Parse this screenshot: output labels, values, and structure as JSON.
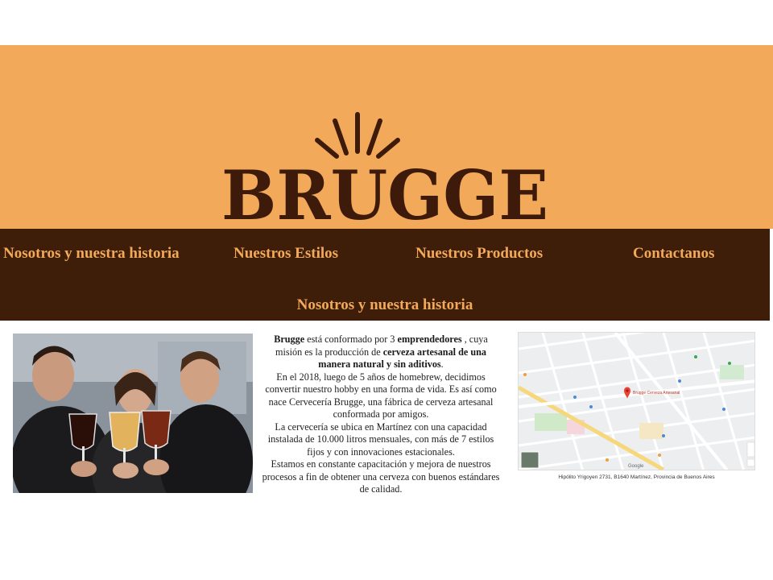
{
  "header": {
    "logo_text": "BRUGGE"
  },
  "nav": {
    "items": [
      {
        "label": "Nosotros y nuestra historia"
      },
      {
        "label": "Nuestros Estilos"
      },
      {
        "label": "Nuestros Productos"
      },
      {
        "label": "Contactanos"
      }
    ]
  },
  "section": {
    "title": "Nosotros y nuestra historia"
  },
  "about": {
    "brand": "Brugge",
    "p1_a": " está conformado por 3 ",
    "p1_b": "emprendedores",
    "p1_c": " , cuya misión es la producción de ",
    "p1_d": "cerveza artesanal de una manera natural y sin aditivos",
    "p1_e": ".",
    "p2": "En el 2018, luego de 5 años de homebrew, decidimos convertir nuestro hobby en una forma de vida. Es así como nace Cervecería Brugge, una fábrica de cerveza artesanal conformada por amigos.",
    "p3": "La cervecería se ubica en Martínez con una capacidad instalada de 10.000 litros mensuales, con más de 7 estilos fijos y con innovaciones estacionales.",
    "p4": "Estamos en constante capacitación y mejora de nuestros procesos a fin de obtener una cerveza con buenos estándares de calidad."
  },
  "map": {
    "caption": "Hipólito Yrigoyen 2731, B1640 Martínez, Provincia de Buenos Aires",
    "pin_label": "Brugge Cerveza Artesanal",
    "google_label": "Google"
  },
  "colors": {
    "banner": "#f3a95a",
    "navbar": "#3f1e09",
    "nav_text": "#f3a95a",
    "logo": "#3d1a0a"
  }
}
